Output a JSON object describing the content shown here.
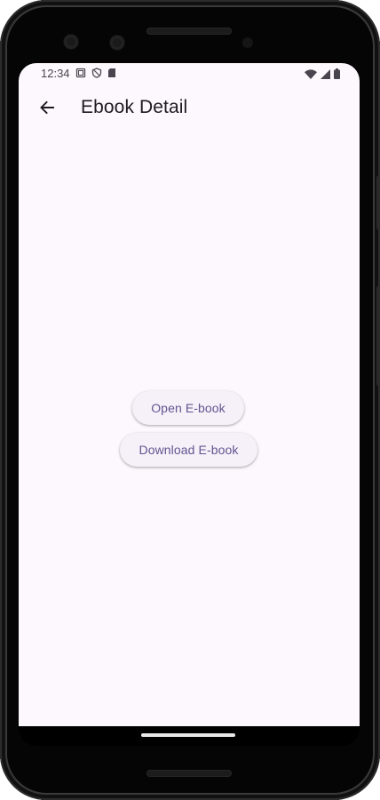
{
  "status_bar": {
    "time": "12:34",
    "left_icons": [
      "screenshot-icon",
      "shield-icon",
      "sd-card-icon"
    ],
    "right_icons": [
      "wifi-icon",
      "cell-signal-icon",
      "battery-icon"
    ]
  },
  "app_bar": {
    "back_icon": "arrow-back-icon",
    "title": "Ebook Detail"
  },
  "main": {
    "open_button_label": "Open E-book",
    "download_button_label": "Download E-book"
  },
  "colors": {
    "background": "#fdf7fe",
    "button_text": "#65558f",
    "button_bg": "#f6f0f9",
    "title_text": "#1d1b20"
  }
}
